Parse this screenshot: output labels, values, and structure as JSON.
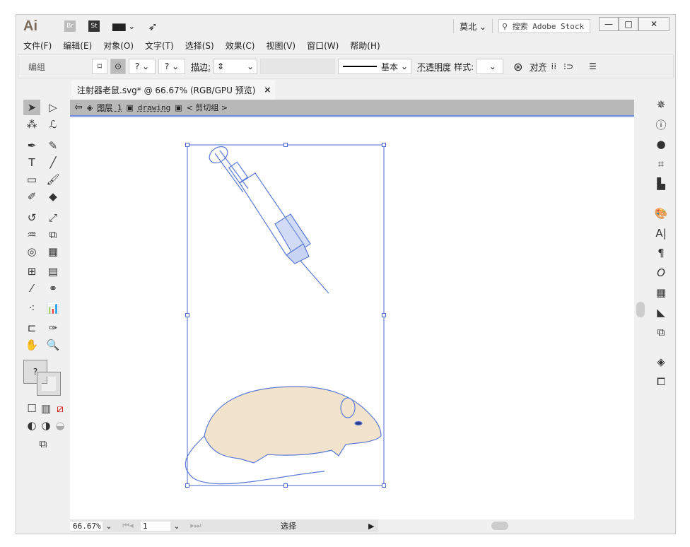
{
  "titlebar": {
    "logo": "Ai",
    "bridge": "Br",
    "stock": "St",
    "workspace": "莫北",
    "search_placeholder": "搜索 Adobe Stock",
    "minimize": "—",
    "maximize": "□",
    "close": "✕"
  },
  "menu": [
    "文件(F)",
    "编辑(E)",
    "对象(O)",
    "文字(T)",
    "选择(S)",
    "效果(C)",
    "视图(V)",
    "窗口(W)",
    "帮助(H)"
  ],
  "control": {
    "selection_label": "编组",
    "q1": "?",
    "q2": "?",
    "stroke_label": "描边:",
    "stroke_style": "基本",
    "opacity_label": "不透明度",
    "style_label": "样式:",
    "align_label": "对齐"
  },
  "document": {
    "tab_title": "注射器老鼠.svg* @ 66.67% (RGB/GPU 预览)",
    "tab_close": "×"
  },
  "breadcrumb": {
    "layer": "图层 1",
    "group": "drawing",
    "clip": "< 剪切组 >"
  },
  "status": {
    "zoom": "66.67%",
    "artboard": "1",
    "tool": "选择"
  },
  "colors": {
    "accent": "#6d8be0",
    "selection": "#4a6ad0",
    "mouse_fill": "#f2e3cc",
    "outline": "#5a7ad8"
  }
}
